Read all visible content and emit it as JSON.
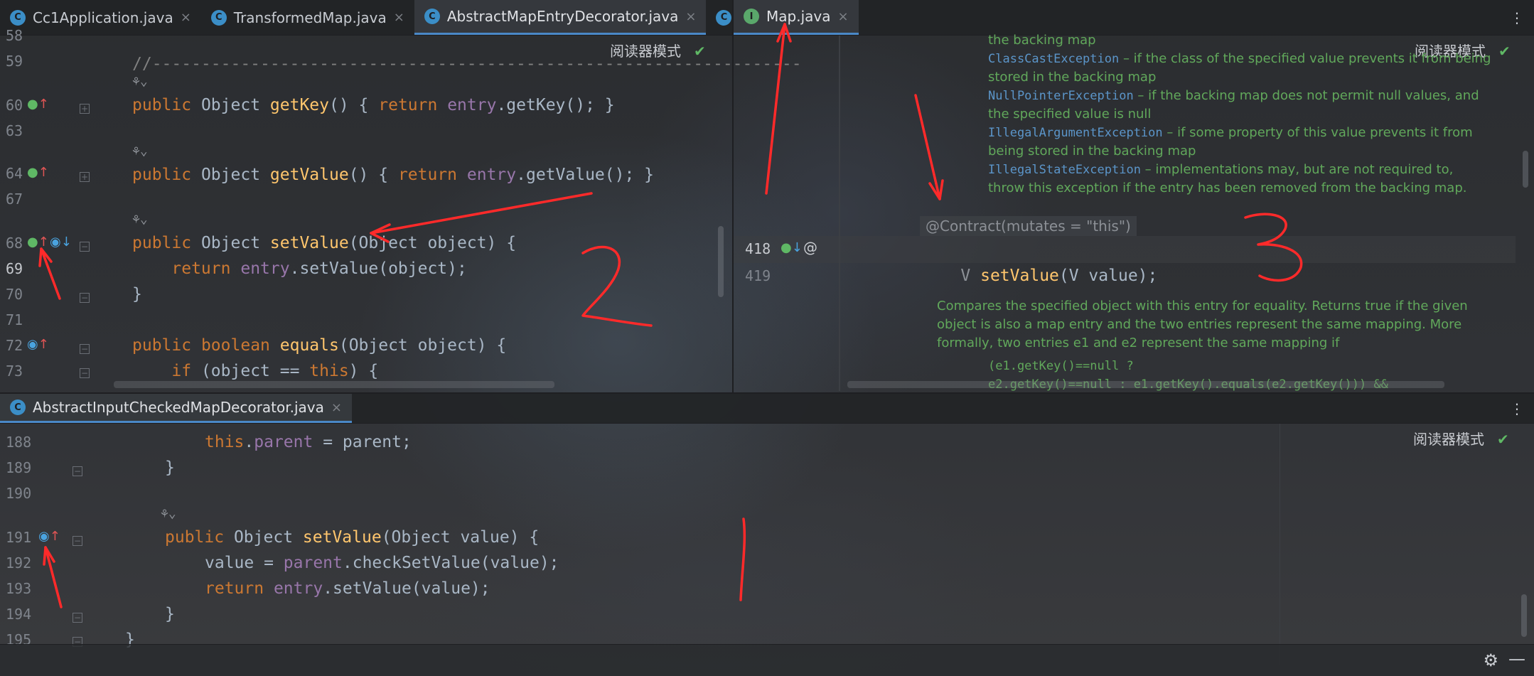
{
  "top_left": {
    "tabs": [
      {
        "icon": "class-icon",
        "label": "Cc1Application.java",
        "active": false
      },
      {
        "icon": "class-icon",
        "label": "TransformedMap.java",
        "active": false
      },
      {
        "icon": "class-icon",
        "label": "AbstractMapEntryDecorator.java",
        "active": true
      },
      {
        "icon": "class-icon",
        "label": "",
        "active": false
      }
    ],
    "reader_mode": "阅读器模式",
    "lines": [
      {
        "num": "58",
        "text": ""
      },
      {
        "num": "59",
        "text": "//------------------------------------------------------------------"
      },
      {
        "num": "",
        "text": "hint"
      },
      {
        "num": "60",
        "text": "public Object getKey() { return entry.getKey(); }"
      },
      {
        "num": "63",
        "text": ""
      },
      {
        "num": "",
        "text": "hint"
      },
      {
        "num": "64",
        "text": "public Object getValue() { return entry.getValue(); }"
      },
      {
        "num": "67",
        "text": ""
      },
      {
        "num": "",
        "text": "hint"
      },
      {
        "num": "68",
        "text": "public Object setValue(Object object) {"
      },
      {
        "num": "69",
        "text": "    return entry.setValue(object);"
      },
      {
        "num": "70",
        "text": "}"
      },
      {
        "num": "71",
        "text": ""
      },
      {
        "num": "72",
        "text": "public boolean equals(Object object) {"
      },
      {
        "num": "73",
        "text": "    if (object == this) {"
      }
    ]
  },
  "top_right": {
    "tab": {
      "icon": "interface-icon",
      "label": "Map.java"
    },
    "reader_mode": "阅读器模式",
    "doc_lines": [
      {
        "type": "text",
        "text": "the backing map"
      },
      {
        "type": "ex",
        "ex": "ClassCastException",
        "text": " – if the class of the specified value prevents it from being"
      },
      {
        "type": "text",
        "text": "stored in the backing map"
      },
      {
        "type": "ex",
        "ex": "NullPointerException",
        "text": " – if the backing map does not permit null values, and"
      },
      {
        "type": "text",
        "text": "the specified value is null"
      },
      {
        "type": "ex",
        "ex": "IllegalArgumentException",
        "text": " – if some property of this value prevents it from"
      },
      {
        "type": "text",
        "text": "being stored in the backing map"
      },
      {
        "type": "ex",
        "ex": "IllegalStateException",
        "text": " – implementations may, but are not required to,"
      },
      {
        "type": "text",
        "text": "throw this exception if the entry has been removed from the backing map."
      }
    ],
    "annotation": "@Contract(mutates = \"this\")",
    "line418": "418",
    "line419": "419",
    "signature": {
      "type": "V",
      "method": "setValue",
      "param": "(V value);"
    },
    "doc2": [
      "Compares the specified object with this entry for equality. Returns true if the given",
      "object is also a map entry and the two entries represent the same mapping. More",
      "formally, two entries e1 and e2 represent the same mapping if"
    ],
    "doc2_code": [
      "(e1.getKey()==null ?",
      "  e2.getKey()==null : e1.getKey().equals(e2.getKey()))  &&"
    ]
  },
  "bottom": {
    "tab": {
      "icon": "class-icon",
      "label": "AbstractInputCheckedMapDecorator.java"
    },
    "reader_mode": "阅读器模式",
    "lines": [
      {
        "num": "188",
        "text": "this.parent = parent;"
      },
      {
        "num": "189",
        "text": "}"
      },
      {
        "num": "190",
        "text": ""
      },
      {
        "num": "",
        "text": "hint"
      },
      {
        "num": "191",
        "text": "public Object setValue(Object value) {"
      },
      {
        "num": "192",
        "text": "value = parent.checkSetValue(value);"
      },
      {
        "num": "193",
        "text": "return entry.setValue(value);"
      },
      {
        "num": "194",
        "text": "}"
      },
      {
        "num": "195",
        "text": "}"
      }
    ]
  },
  "annotations": {
    "num1": "1",
    "num2": "2",
    "num3": "3",
    "color": "#ff2a2a"
  },
  "icons": {
    "gear": "gear-icon",
    "check": "check-icon"
  }
}
